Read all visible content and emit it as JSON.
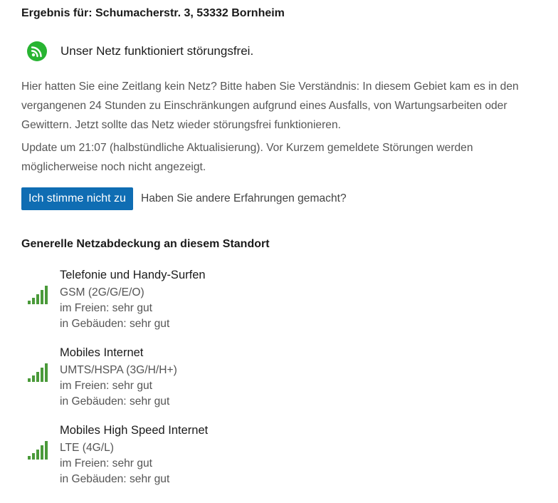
{
  "result": {
    "title": "Ergebnis für: Schumacherstr. 3, 53332 Bornheim"
  },
  "status": {
    "icon": "wifi-signal-icon",
    "color": "#28b432",
    "text": "Unser Netz funktioniert störungsfrei."
  },
  "info": {
    "paragraph1": "Hier hatten Sie eine Zeitlang kein Netz? Bitte haben Sie Verständnis: In diesem Gebiet kam es in den vergangenen 24 Stunden zu Einschränkungen aufgrund eines Ausfalls, von Wartungsarbeiten oder Gewittern. Jetzt sollte das Netz wieder störungsfrei funktionieren.",
    "paragraph2": "Update um 21:07 (halbstündliche Aktualisierung). Vor Kurzem gemeldete Störungen werden möglicherweise noch nicht angezeigt."
  },
  "feedback": {
    "button_label": "Ich stimme nicht zu",
    "button_color": "#0f6db3",
    "question": "Haben Sie andere Erfahrungen gemacht?"
  },
  "coverage": {
    "heading": "Generelle Netzabdeckung an diesem Standort",
    "signal_color": "#4a9a3a",
    "items": [
      {
        "title": "Telefonie und Handy-Surfen",
        "technology": "GSM (2G/G/E/O)",
        "outdoor": "im Freien: sehr gut",
        "indoor": "in Gebäuden: sehr gut",
        "signal_level": "5 of 5"
      },
      {
        "title": "Mobiles Internet",
        "technology": "UMTS/HSPA (3G/H/H+)",
        "outdoor": "im Freien: sehr gut",
        "indoor": "in Gebäuden: sehr gut",
        "signal_level": "5 of 5"
      },
      {
        "title": "Mobiles High Speed Internet",
        "technology": "LTE (4G/L)",
        "outdoor": "im Freien: sehr gut",
        "indoor": "in Gebäuden: sehr gut",
        "signal_level": "5 of 5"
      }
    ]
  }
}
